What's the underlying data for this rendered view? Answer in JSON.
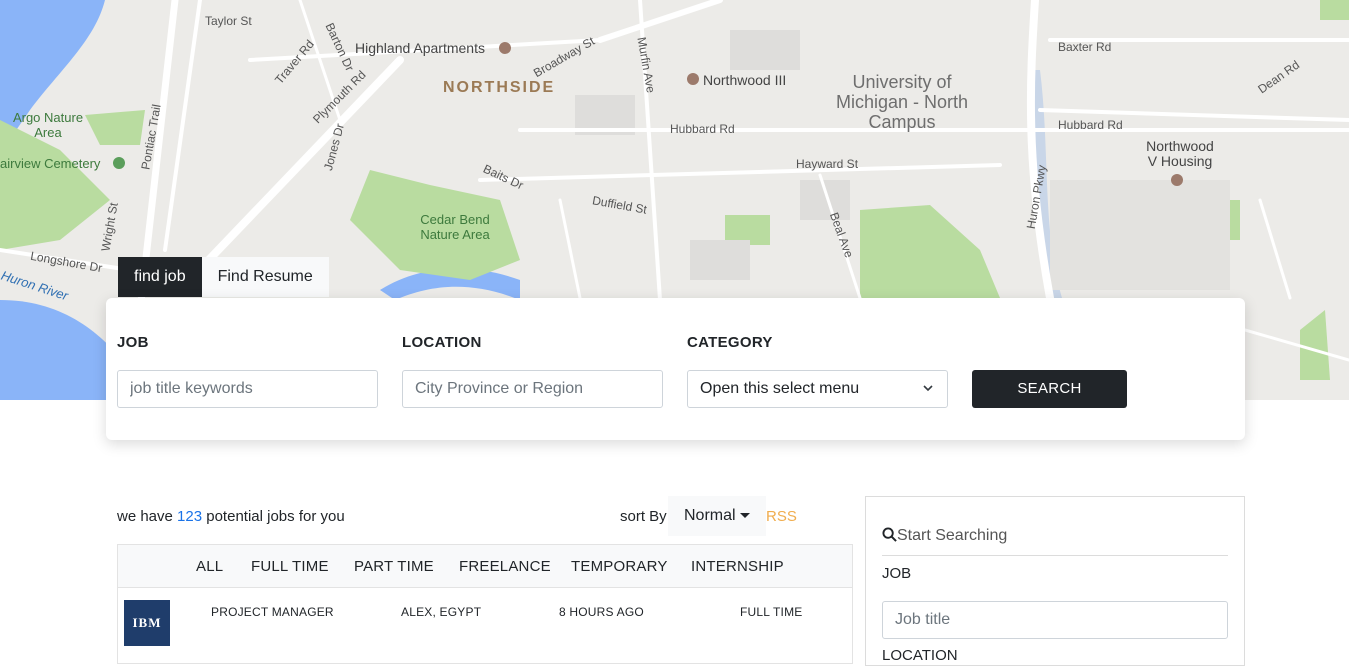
{
  "map": {
    "labels": {
      "highland": "Highland Apartments",
      "northside": "NORTHSIDE",
      "northwood3": "Northwood III",
      "umich": "University of Michigan - North Campus",
      "northwood5": "Northwood V Housing",
      "argo": "Argo Nature Area",
      "fairview": "airview Cemetery",
      "cedarbend": "Cedar Bend Nature Area",
      "huron_river": "Huron River",
      "taylor": "Taylor St",
      "traver": "Traver Rd",
      "barton": "Barton Dr",
      "plymouth": "Plymouth Rd",
      "broadway": "Broadway St",
      "murfin": "Murfin Ave",
      "hubbard": "Hubbard Rd",
      "hubbard2": "Hubbard Rd",
      "hayward": "Hayward St",
      "baits": "Baits Dr",
      "duffield": "Duffield St",
      "beal": "Beal Ave",
      "huron_pkwy": "Huron Pkwy",
      "baxter": "Baxter Rd",
      "dean": "Dean Rd",
      "pontiac": "Pontiac Trail",
      "wright": "Wright St",
      "longshore": "Longshore Dr",
      "jones": "Jones Dr"
    }
  },
  "tabs": [
    {
      "label": "find job",
      "active": true
    },
    {
      "label": "Find Resume",
      "active": false
    }
  ],
  "search": {
    "job_label": "JOB",
    "job_placeholder": "job title keywords",
    "location_label": "LOCATION",
    "location_placeholder": "City Province or Region",
    "category_label": "CATEGORY",
    "category_selected": "Open this select menu",
    "button_label": "SEARCH"
  },
  "results": {
    "prefix": "we have",
    "count": "123",
    "suffix": "potential jobs for you",
    "sort_label": "sort By",
    "sort_value": "Normal",
    "rss_label": "RSS"
  },
  "filters": [
    "ALL",
    "FULL TIME",
    "PART TIME",
    "FREELANCE",
    "TEMPORARY",
    "INTERNSHIP"
  ],
  "jobs": [
    {
      "logo": "IBM",
      "title": "PROJECT MANAGER",
      "location": "ALEX, EGYPT",
      "posted": "8 HOURS AGO",
      "type": "FULL TIME"
    }
  ],
  "sidebar": {
    "search_heading": "Start Searching",
    "job_label": "JOB",
    "job_placeholder": "Job title",
    "location_label": "LOCATION"
  },
  "colors": {
    "dark": "#212529",
    "link": "#1a73e8",
    "rss": "#f0ad4e",
    "map_bg": "#ecebe8",
    "park": "#b9dca0",
    "water": "#8ab4f8"
  }
}
